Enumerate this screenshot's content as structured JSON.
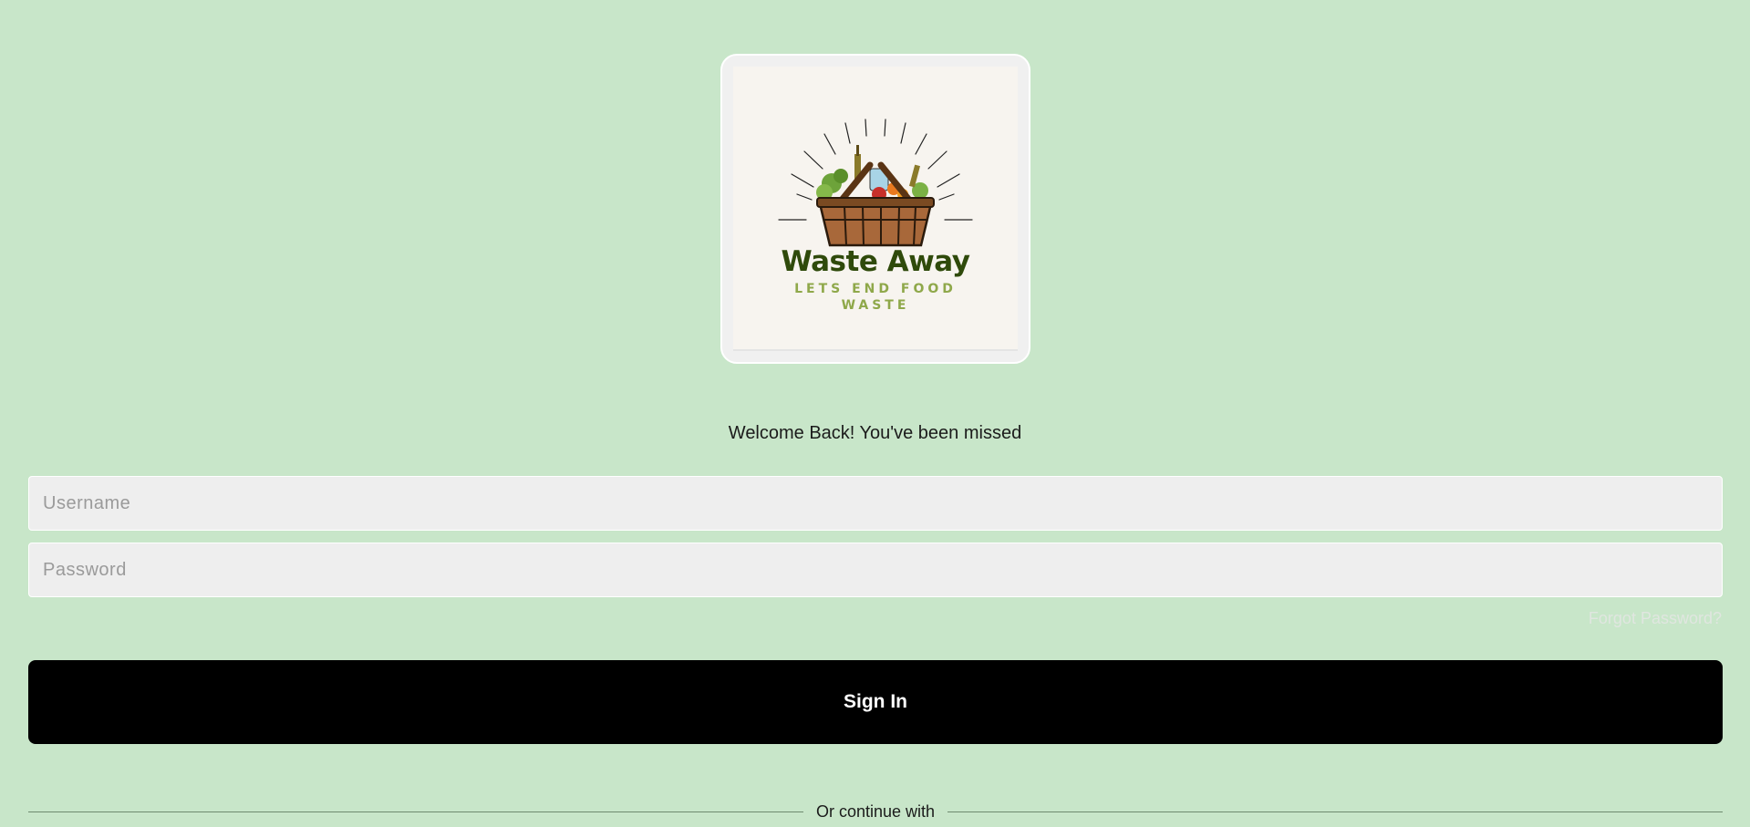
{
  "app": {
    "brand_name": "Waste Away",
    "brand_tagline": "LETS END FOOD WASTE"
  },
  "login": {
    "welcome_text": "Welcome Back! You've been missed",
    "username_placeholder": "Username",
    "password_placeholder": "Password",
    "forgot_password_label": "Forgot Password?",
    "signin_label": "Sign In",
    "continue_with_label": "Or continue with"
  },
  "colors": {
    "background": "#c8e6c9",
    "button": "#000000",
    "brand_dark_green": "#2f4a0b",
    "brand_light_green": "#8fa84a"
  },
  "icons": {
    "logo": "basket-of-groceries-logo"
  }
}
